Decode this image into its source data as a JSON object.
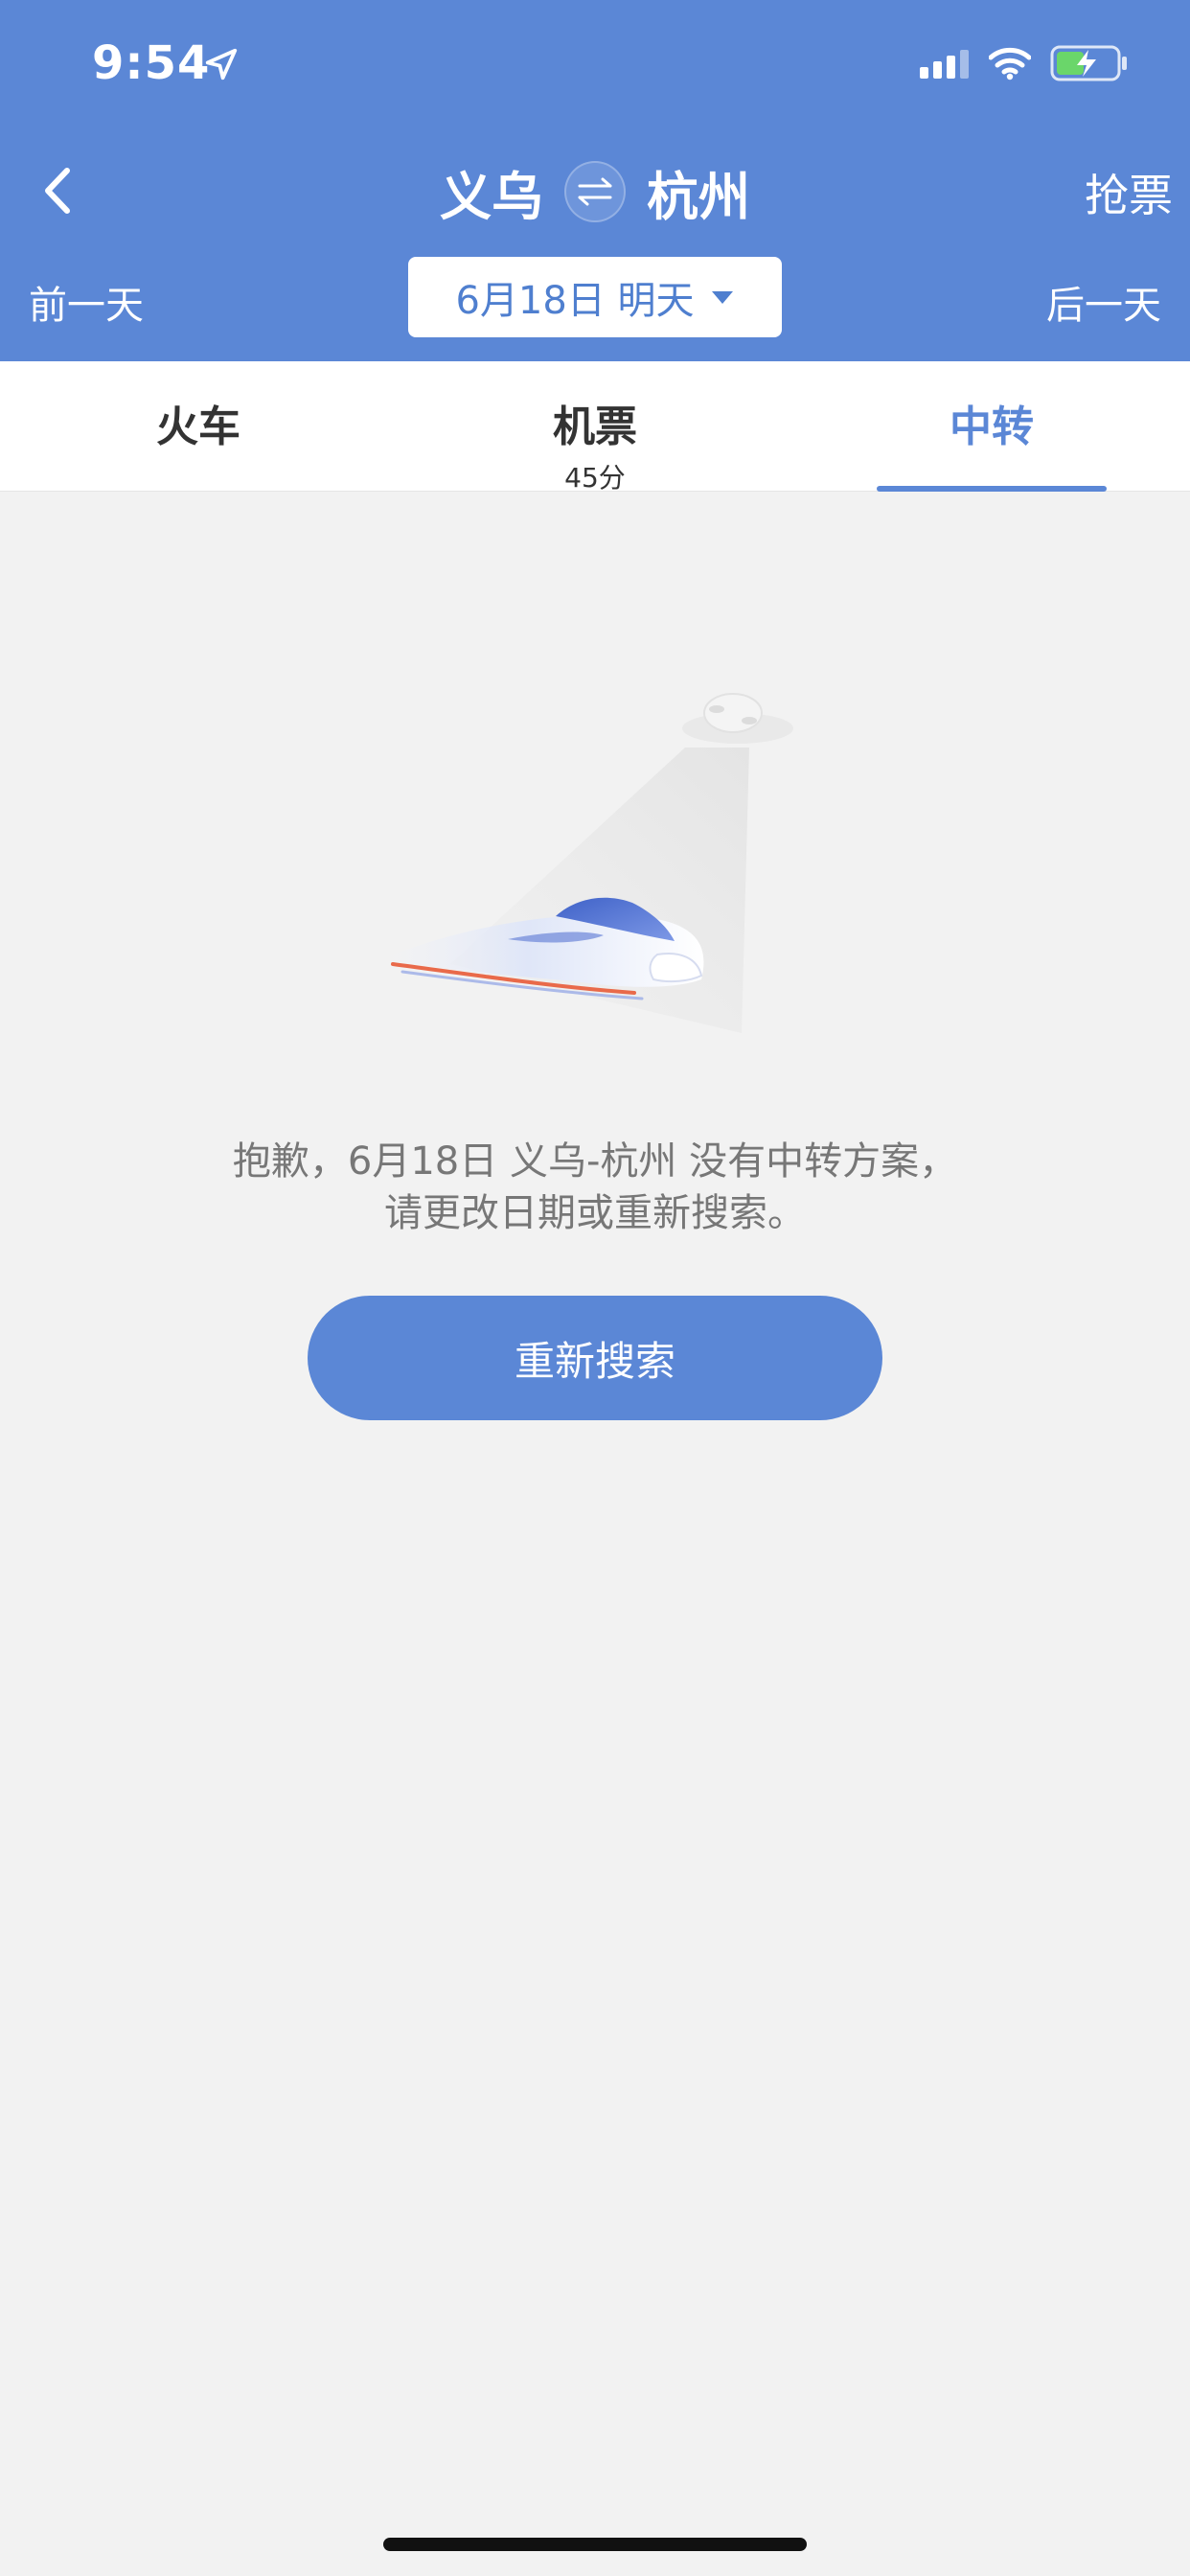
{
  "status_bar": {
    "time": "9:54"
  },
  "nav": {
    "origin": "义乌",
    "destination": "杭州",
    "grab_label": "抢票"
  },
  "date_row": {
    "prev_label": "前一天",
    "date_label": "6月18日 明天",
    "next_label": "后一天"
  },
  "tabs": [
    {
      "label": "火车",
      "sub": "",
      "active": false
    },
    {
      "label": "机票",
      "sub": "45分",
      "active": false
    },
    {
      "label": "中转",
      "sub": "",
      "active": true
    }
  ],
  "empty_state": {
    "line1": "抱歉，6月18日 义乌-杭州 没有中转方案，",
    "line2": "请更改日期或重新搜索。",
    "button_label": "重新搜索"
  },
  "colors": {
    "brand_blue": "#5b87d6",
    "date_text": "#4f7fcf",
    "background": "#f2f2f2",
    "battery_fill": "#6ad66a"
  },
  "icons": [
    "location-arrow-icon",
    "signal-icon",
    "wifi-icon",
    "battery-charging-icon",
    "back-chevron-icon",
    "swap-icon",
    "dropdown-caret-icon"
  ]
}
